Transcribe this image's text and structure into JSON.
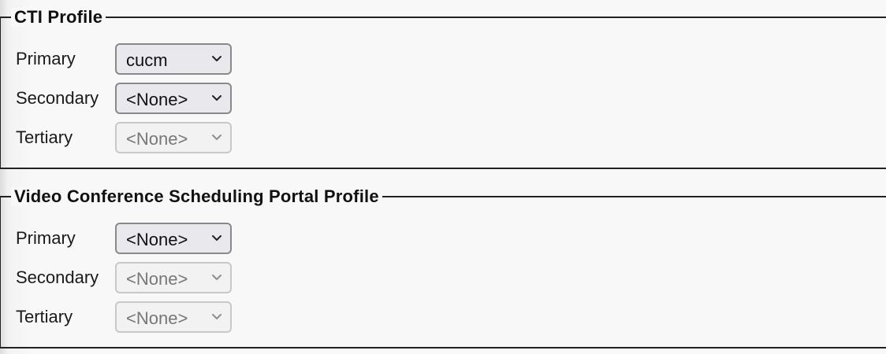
{
  "cti_profile": {
    "legend": "CTI Profile",
    "primary": {
      "label": "Primary",
      "value": "cucm",
      "enabled": true
    },
    "secondary": {
      "label": "Secondary",
      "value": "<None>",
      "enabled": true
    },
    "tertiary": {
      "label": "Tertiary",
      "value": "<None>",
      "enabled": false
    }
  },
  "video_profile": {
    "legend": "Video Conference Scheduling Portal Profile",
    "primary": {
      "label": "Primary",
      "value": "<None>",
      "enabled": true
    },
    "secondary": {
      "label": "Secondary",
      "value": "<None>",
      "enabled": false
    },
    "tertiary": {
      "label": "Tertiary",
      "value": "<None>",
      "enabled": false
    }
  },
  "icons": {
    "dropdown": "chevron-down-icon"
  },
  "colors": {
    "border": "#222222",
    "select_enabled_bg": "#e9e9ed",
    "select_disabled_text": "#777777"
  }
}
